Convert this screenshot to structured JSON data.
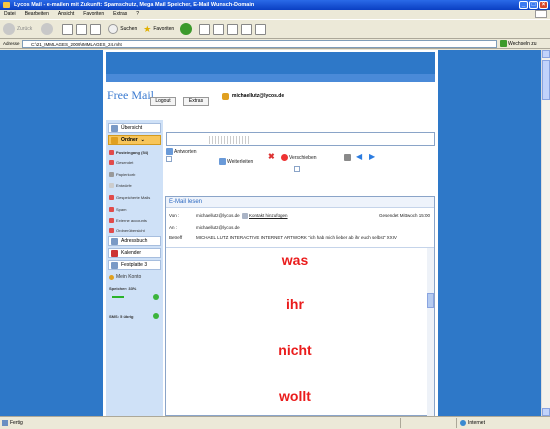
{
  "window": {
    "title": "Lycos Mail - e-mailen mit Zukunft: Spamschutz, Mega Mail Speicher, E-Mail Wunsch-Domain",
    "controls": [
      "_",
      "□",
      "×"
    ]
  },
  "menu": [
    "Datei",
    "Bearbeiten",
    "Ansicht",
    "Favoriten",
    "Extras",
    "?"
  ],
  "toolbar": {
    "back_label": "Zurück",
    "search_label": "Suchen",
    "favorites_label": "Favoriten"
  },
  "address": {
    "label": "Adresse",
    "url": "C:\\21_IMMLAGES_2009\\IMMLAGES_24.mht",
    "go_label": "Wechseln zu"
  },
  "header": {
    "brand": "Free Mail",
    "logout_label": "Logout",
    "extras_label": "Extras",
    "user_email": "michaellutz@lycos.de"
  },
  "sidebar": {
    "overview": "Übersicht",
    "ordner_label": "Ordner",
    "folders": [
      "Posteingang (54)",
      "Gesendet",
      "Papierkorb",
      "Entwürfe",
      "Gespeicherte Mails",
      "Spam",
      "Externe accounts",
      "Ordnerübersicht"
    ],
    "adressbuch": "Adressbuch",
    "kalender": "Kalender",
    "festplatte": "Festplatte 3",
    "mein_konto": "Mein Konto",
    "speicher": "Speicher: 33%",
    "sms": "SMS: 5 übrig"
  },
  "actions": {
    "antworten": "Antworten",
    "weiterleiten": "Weiterleiten",
    "verschieben": "Verschieben"
  },
  "mail": {
    "panel_title": "E-Mail lesen",
    "from_label": "Von :",
    "from_value": "michaellutz@lycos.de",
    "add_contact": "Kontakt hinzufügen",
    "date": "Gesendet Mittwoch 15:00",
    "to_label": "An :",
    "to_value": "michaellutz@lycos.de",
    "subject_label": "Betreff",
    "subject_value": "MICHAEL LUTZ INTERACTIVE INTERNET ARTWORK \"ich hab mich lieber ab ihr euch selbst\" XXIV",
    "body_lines": [
      "was",
      "ihr",
      "nicht",
      "wollt"
    ]
  },
  "status": {
    "left": "Fertig",
    "zone": "Internet"
  },
  "colors": {
    "page_bg": "#2e78c8",
    "body_text": "#ea1c1c",
    "accent": "#f7c55a"
  }
}
